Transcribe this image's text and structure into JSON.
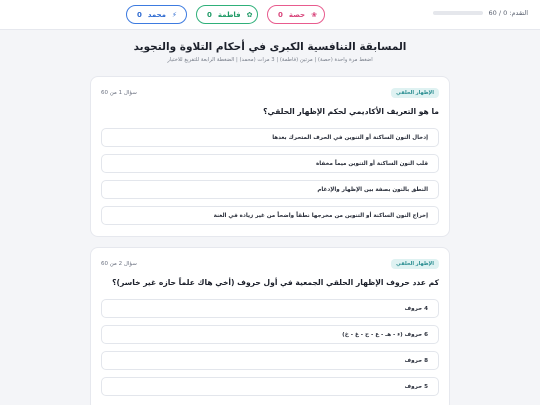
{
  "progress": {
    "label": "التقدم: 0 / 60",
    "fraction": 0.0
  },
  "players": [
    {
      "name": "حصة",
      "score": "0",
      "icon": "flower-icon",
      "color": "#e85b8e"
    },
    {
      "name": "فاطمة",
      "score": "0",
      "icon": "hibiscus-icon",
      "color": "#2fb07a"
    },
    {
      "name": "محمد",
      "score": "0",
      "icon": "lightning-icon",
      "color": "#3d7be0"
    }
  ],
  "header": {
    "title": "المسابقة التنافسية الكبرى في أحكام التلاوة والتجويد",
    "subtitle": "اضغط مرة واحدة (حصة) | مرتين (فاطمة) | 3 مرات (محمد) | الضغطة الرابعة للتفريغ للاختيار"
  },
  "questions": [
    {
      "badge": "الإظهار الحلقي",
      "count": "سؤال 1 من 60",
      "text": "ما هو التعريف الأكاديمي لحكم الإظهار الحلقي؟",
      "options": [
        "إدخال النون الساكنة أو التنوين في الحرف المتحرك بعدها",
        "قلب النون الساكنة أو التنوين ميماً مخفاة",
        "النطق بالنون بصفة بين الإظهار والإدغام",
        "إخراج النون الساكنة أو التنوين من مخرجها نطقاً واضحاً من غير زيادة في الغنة"
      ]
    },
    {
      "badge": "الإظهار الحلقي",
      "count": "سؤال 2 من 60",
      "text": "كم عدد حروف الإظهار الحلقي الجمعية في أول حروف (أخي هاك علماً حازه غير خاسر)؟",
      "options": [
        "4 حروف",
        "6 حروف (ء - هـ - ع - ح - غ - خ)",
        "8 حروف",
        "5 حروف"
      ]
    }
  ]
}
